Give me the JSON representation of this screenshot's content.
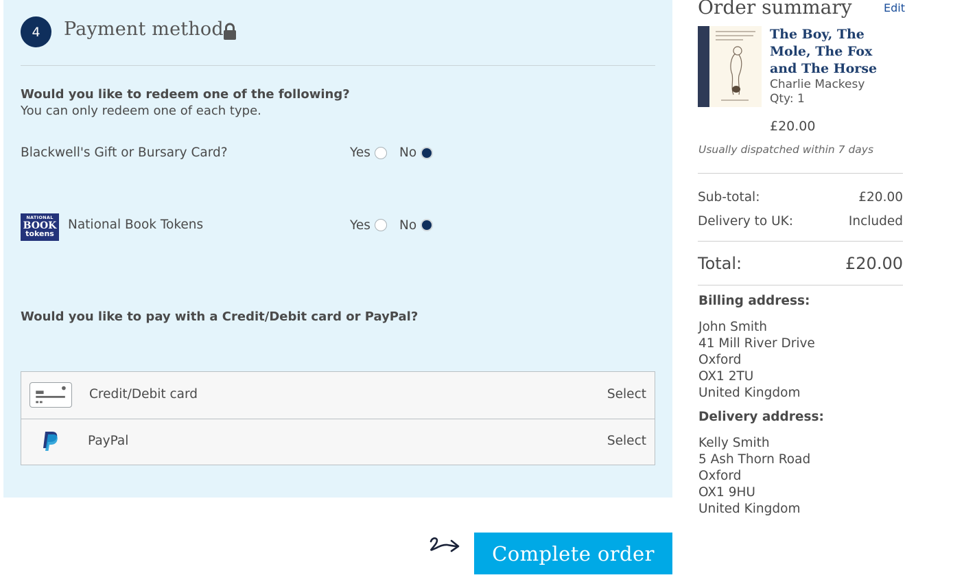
{
  "payment": {
    "step_number": "4",
    "title": "Payment method",
    "redeem_question": "Would you like to redeem one of the following?",
    "redeem_note": "You can only redeem one of each type.",
    "gift_card": {
      "label": "Blackwell's Gift or Bursary Card?",
      "yes": "Yes",
      "no": "No",
      "selected": "No"
    },
    "book_tokens": {
      "label": "National Book Tokens",
      "yes": "Yes",
      "no": "No",
      "selected": "No",
      "logo_line1": "NATIONAL",
      "logo_line2": "BOOK",
      "logo_line3": "tokens"
    },
    "pay_question": "Would you like to pay with a Credit/Debit card or PayPal?",
    "options": [
      {
        "label": "Credit/Debit card",
        "action": "Select",
        "icon": "credit-card-icon"
      },
      {
        "label": "PayPal",
        "action": "Select",
        "icon": "paypal-icon"
      }
    ]
  },
  "complete_button": "Complete order",
  "summary": {
    "title": "Order summary",
    "edit": "Edit",
    "item": {
      "title": "The Boy, The Mole, The Fox and The Horse",
      "author": "Charlie Mackesy",
      "qty": "Qty: 1",
      "price": "£20.00",
      "dispatch": "Usually dispatched within 7 days"
    },
    "subtotal_label": "Sub-total:",
    "subtotal_value": "£20.00",
    "delivery_label": "Delivery to UK:",
    "delivery_value": "Included",
    "total_label": "Total:",
    "total_value": "£20.00",
    "billing": {
      "heading": "Billing address:",
      "lines": [
        "John Smith",
        "41 Mill River Drive",
        "Oxford",
        "OX1 2TU",
        "United Kingdom"
      ]
    },
    "delivery": {
      "heading": "Delivery address:",
      "lines": [
        "Kelly Smith",
        "5 Ash Thorn Road",
        "Oxford",
        "OX1 9HU",
        "United Kingdom"
      ]
    }
  },
  "colors": {
    "panel_bg": "#e4f4fb",
    "navy": "#0f2f5c",
    "button": "#00a9e6",
    "link": "#1a4e9a"
  }
}
